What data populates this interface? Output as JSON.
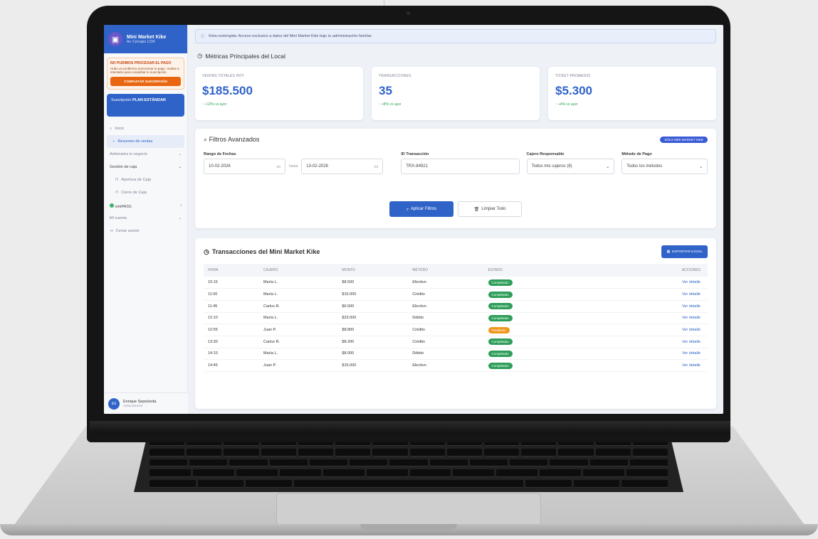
{
  "app": {
    "name": "Mini Market Kike",
    "subtitle": "Av. Cerrajes 1234"
  },
  "sidebar": {
    "alert": {
      "title": "NO PUDIMOS PROCESAR EL PAGO",
      "text": "Hubo un problema al procesar tu pago. Vuelve a intentarlo para completar tu suscripción.",
      "button": "COMPLETAR SUSCRIPCIÓN"
    },
    "plan": {
      "prefix": "Suscripción",
      "name": "PLAN ESTÁNDAR"
    },
    "items": [
      {
        "label": "Inicio",
        "icon": "home-icon"
      },
      {
        "label": "Resumen de ventas",
        "icon": "chart-icon"
      }
    ],
    "section_business": "Administra tu negocio",
    "section_cash": "Gestión de caja",
    "cash_items": [
      "Apertura de Caja",
      "Cierre de Caja"
    ],
    "section_pass": "omiPASS",
    "section_account": "Mi cuenta",
    "logout": "Cerrar sesión",
    "user": {
      "initials": "ES",
      "name": "Enrique Sepulveda",
      "role": "Administrador"
    }
  },
  "notice": "Vista restringida: Acceso exclusivo a datos del Mini Market Kike bajo tu administración familiar.",
  "metrics": {
    "title": "Métricas Principales del Local",
    "cards": [
      {
        "label": "VENTAS TOTALES HOY",
        "value": "$185.500",
        "delta": "↑ +12% vs ayer"
      },
      {
        "label": "TRANSACCIONES",
        "value": "35",
        "delta": "↑ +8% vs ayer"
      },
      {
        "label": "TICKET PROMEDIO",
        "value": "$5.300",
        "delta": "↑ +4% vs ayer"
      }
    ]
  },
  "filters": {
    "title": "Filtros Avanzados",
    "badge": "SÓLO MINI MARKET KIKE",
    "date_label": "Rango de Fechas",
    "date_from": "10-02-2026",
    "date_sep": "hasta",
    "date_to": "13-02-2026",
    "id_label": "ID Transacción",
    "id_value": "TRX-84921",
    "cashier_label": "Cajero Responsable",
    "cashier_value": "Todos mis cajeros (8)",
    "method_label": "Método de Pago",
    "method_value": "Todos los métodos",
    "apply": "Aplicar Filtros",
    "clear": "Limpiar Todo"
  },
  "transactions": {
    "title": "Transacciones del Mini Market Kike",
    "export": "EXPORTAR EXCEL",
    "columns": [
      "HORA",
      "CAJERO",
      "MONTO",
      "MÉTODO",
      "ESTADO",
      "ACCIONES"
    ],
    "rows": [
      {
        "hora": "10:15",
        "cajero": "María L.",
        "monto": "$8.500",
        "metodo": "Efectivo",
        "estado": "Completado",
        "accion": "Ver detalle"
      },
      {
        "hora": "11:00",
        "cajero": "María L.",
        "monto": "$15.000",
        "metodo": "Crédito",
        "estado": "Completado",
        "accion": "Ver detalle"
      },
      {
        "hora": "11:45",
        "cajero": "Carlos R.",
        "monto": "$6.500",
        "metodo": "Efectivo",
        "estado": "Completado",
        "accion": "Ver detalle"
      },
      {
        "hora": "12:10",
        "cajero": "María L.",
        "monto": "$23.000",
        "metodo": "Débito",
        "estado": "Completado",
        "accion": "Ver detalle"
      },
      {
        "hora": "12:55",
        "cajero": "Juan P.",
        "monto": "$8.800",
        "metodo": "Crédito",
        "estado": "Pendiente",
        "accion": "Ver detalle"
      },
      {
        "hora": "13:30",
        "cajero": "Carlos R.",
        "monto": "$8.200",
        "metodo": "Crédito",
        "estado": "Completado",
        "accion": "Ver detalle"
      },
      {
        "hora": "14:10",
        "cajero": "María L.",
        "monto": "$8.000",
        "metodo": "Débito",
        "estado": "Completado",
        "accion": "Ver detalle"
      },
      {
        "hora": "14:45",
        "cajero": "Juan P.",
        "monto": "$15.000",
        "metodo": "Efectivo",
        "estado": "Completado",
        "accion": "Ver detalle"
      }
    ]
  }
}
